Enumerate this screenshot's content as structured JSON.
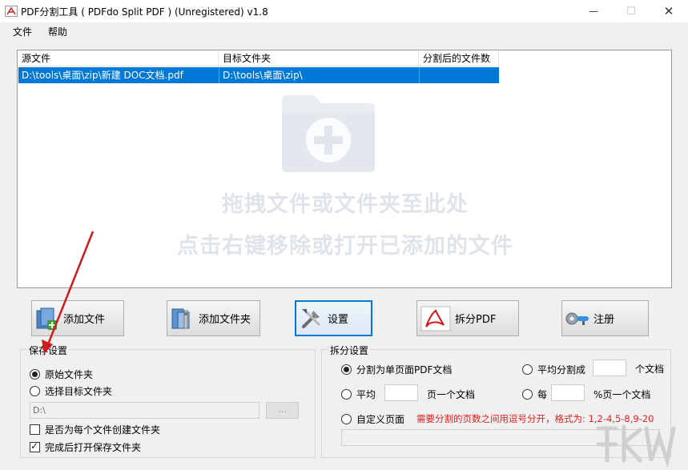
{
  "window": {
    "title": "PDF分割工具 ( PDFdo Split PDF ) (Unregistered) v1.8",
    "minimize_symbol": "—",
    "maximize_symbol": "☐",
    "close_symbol": "✕"
  },
  "menu": {
    "items": [
      "文件",
      "帮助"
    ]
  },
  "file_list": {
    "columns": [
      "源文件",
      "目标文件夹",
      "分割后的文件数"
    ],
    "rows": [
      {
        "source": "D:\\tools\\桌面\\zip\\新建 DOC文档.pdf",
        "target": "D:\\tools\\桌面\\zip\\",
        "count": ""
      }
    ],
    "hint_line1": "拖拽文件或文件夹至此处",
    "hint_line2": "点击右键移除或打开已添加的文件"
  },
  "toolbar": {
    "add_file": "添加文件",
    "add_folder": "添加文件夹",
    "settings": "设置",
    "split_pdf": "拆分PDF",
    "register": "注册"
  },
  "save_settings": {
    "legend": "保存设置",
    "original_folder": "原始文件夹",
    "choose_target": "选择目标文件夹",
    "path_value": "D:\\",
    "browse_label": "...",
    "create_per_file": "是否为每个文件创建文件夹",
    "open_after": "完成后打开保存文件夹"
  },
  "split_settings": {
    "legend": "拆分设置",
    "single_page": "分割为单页面PDF文档",
    "split_into": "平均分割成",
    "split_into_suffix": "个文档",
    "average": "平均",
    "average_suffix": "页一个文档",
    "each": "每",
    "each_suffix": "%页一个文档",
    "custom": "自定义页面",
    "custom_note": "需要分割的页数之间用逗号分开，格式为: 1,2-4,5-8,9-20"
  },
  "colors": {
    "selection": "#0078d7",
    "note_red": "#e02020",
    "arrow_red": "#d21a1a"
  }
}
